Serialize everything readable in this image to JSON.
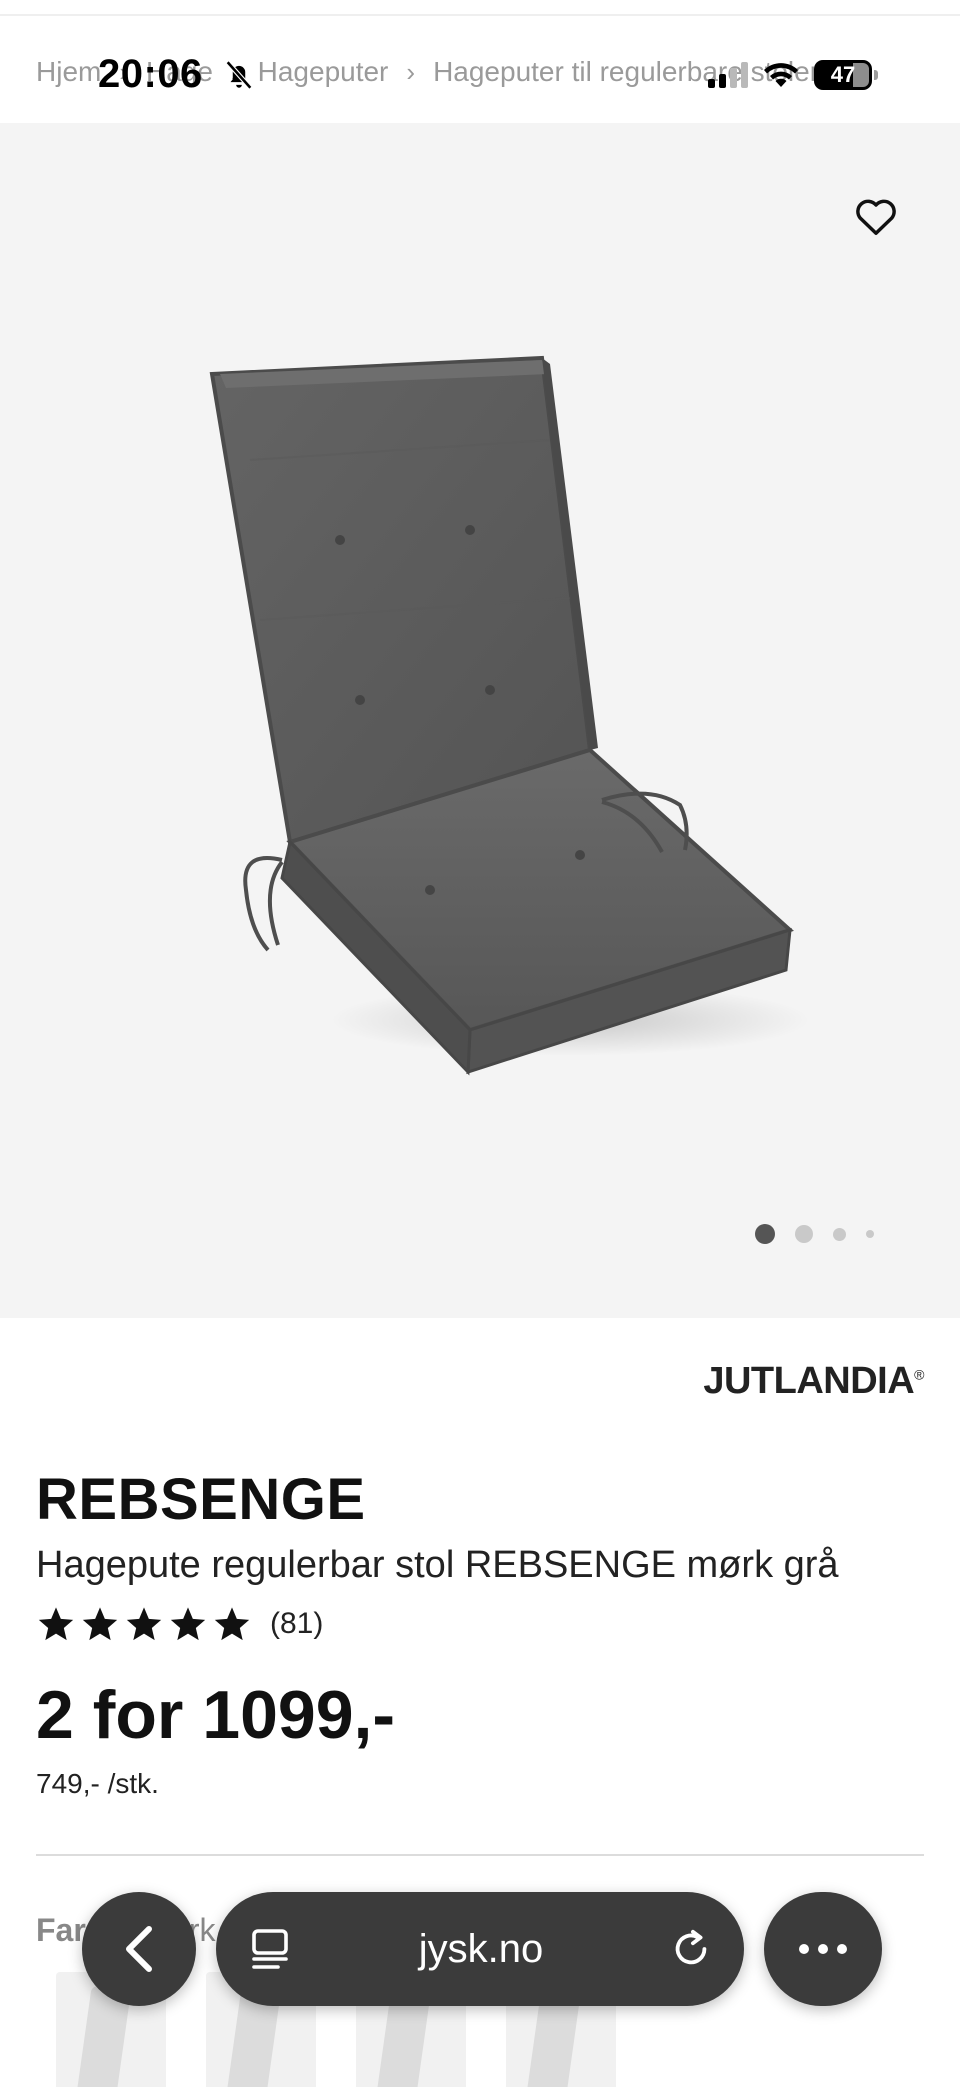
{
  "status_bar": {
    "time": "20:06",
    "battery_level": "47",
    "icons": [
      "bell-slash-icon",
      "cellular-signal-icon",
      "wifi-icon",
      "battery-icon"
    ]
  },
  "breadcrumb": {
    "items": [
      "Hjem",
      "Hage",
      "Hageputer",
      "Hageputer til regulerbare stoler"
    ]
  },
  "gallery": {
    "favorite_icon": "heart-icon",
    "image_count": 4,
    "active_index": 0
  },
  "product": {
    "brand": "JUTLANDIA",
    "brand_mark": "®",
    "name": "REBSENGE",
    "description": "Hagepute regulerbar stol REBSENGE mørk grå",
    "rating_stars": 5,
    "review_count": "(81)",
    "price": "2 for 1099,-",
    "unit_price": "749,- /stk.",
    "color_label": "Farge:",
    "color_value": "Mørk grå"
  },
  "browser_bar": {
    "url": "jysk.no",
    "icons": [
      "back-chevron-icon",
      "reader-icon",
      "reload-icon",
      "more-icon"
    ]
  },
  "colors": {
    "hero_bg": "#f4f4f4",
    "browser_bg": "#3b3b3b",
    "cushion": "#5c5c5c"
  }
}
